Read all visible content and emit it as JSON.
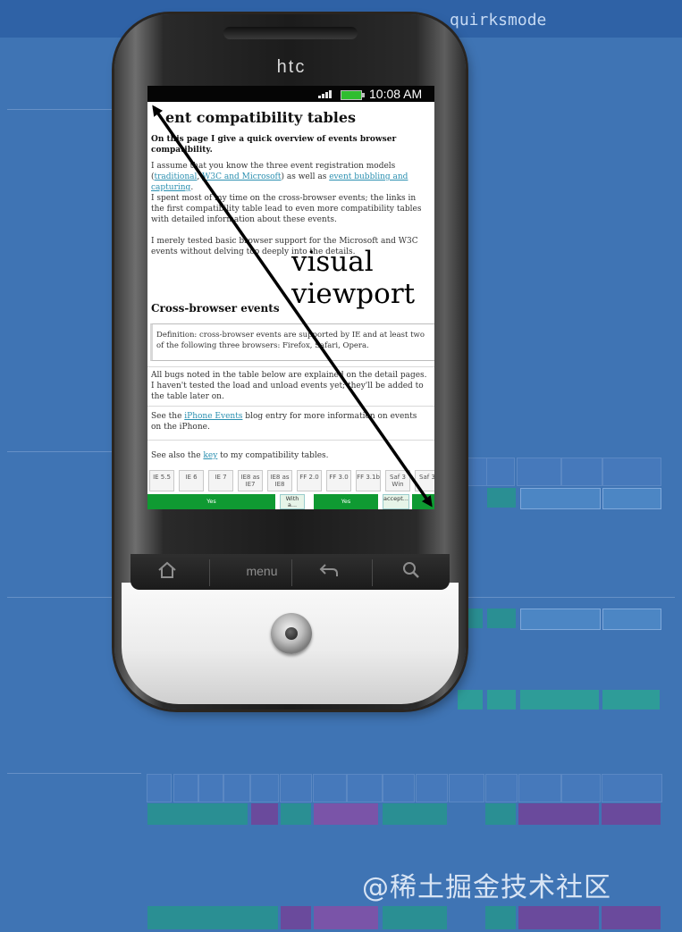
{
  "background": {
    "breadcrumb": "",
    "brand": "quirksmode",
    "color": "#3f74b4"
  },
  "watermark": "@稀土掘金技术社区",
  "phone": {
    "brand": "htc",
    "status_time": "10:08 AM",
    "nav": {
      "menu_label": "menu"
    }
  },
  "screen": {
    "title": "ent compatibility tables",
    "intro": "On this page I give a quick overview of events browser compatibility.",
    "para1_a": "I assume that you know the three event registration models (",
    "para1_link1": "traditional",
    "para1_b": ",",
    "para1_link2": "W3C and Microsoft",
    "para1_c": ") as well as ",
    "para1_link3": "event bubbling and capturing",
    "para1_d": ".",
    "para2": "I spent most of my time on the cross-browser events; the links in the first compatibility table lead to even more compatibility tables with detailed information about these events.",
    "para3": "I merely tested basic browser support for the Microsoft and W3C events without delving too deeply into the details.",
    "h2": "Cross-browser events",
    "definition": "Definition: cross-browser events are supported by IE and at least two of the following three browsers: Firefox, Safari, Opera.",
    "bugs": "All bugs noted in the table below are explained on the detail pages. I haven't tested the load and unload events yet; they'll be added to the table later on.",
    "see_a": "See the ",
    "see_link": "iPhone Events",
    "see_b": " blog entry for more information on events on the iPhone.",
    "also_a": "See also the ",
    "also_link": "key",
    "also_b": " to my compatibility tables.",
    "table_headers": [
      "IE 5.5",
      "IE 6",
      "IE 7",
      "IE8 as IE7",
      "IE8 as IE8",
      "FF 2.0",
      "FF 3.0",
      "FF 3.1b",
      "Saf 3 Win",
      "Saf 3"
    ],
    "yes_label": "Yes",
    "yes_cell_small": "With a...",
    "accept_cell": "accept..."
  },
  "annotation": {
    "label_line1": "visual",
    "label_line2": "viewport"
  },
  "colors": {
    "teal": "#2a8f93",
    "purple": "#6a4a9c",
    "green": "#0f9a32",
    "link": "#2a8fb0"
  }
}
